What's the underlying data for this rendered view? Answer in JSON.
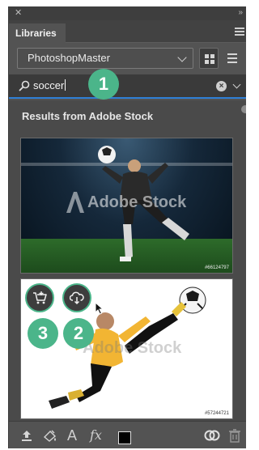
{
  "panel": {
    "close_glyph": "✕",
    "collapse_glyph": "»",
    "tab_label": "Libraries"
  },
  "library": {
    "selected": "PhotoshopMaster"
  },
  "search": {
    "value": "soccer",
    "clear_glyph": "×"
  },
  "results": {
    "title": "Results from Adobe Stock",
    "items": [
      {
        "watermark": "Adobe Stock",
        "id": "#66124797"
      },
      {
        "watermark": "Adobe Stock",
        "id": "#57244721"
      }
    ]
  },
  "steps": [
    "1",
    "2",
    "3"
  ],
  "footer": {
    "text_glyph": "A",
    "fx_glyph": "fx"
  },
  "colors": {
    "panel_bg": "#535353",
    "accent_green": "#4bb58a",
    "search_focus": "#2f7fd6"
  },
  "icons": [
    "close-icon",
    "collapse-icon",
    "panel-menu-icon",
    "chevron-down-icon",
    "grid-view-icon",
    "list-view-icon",
    "search-icon",
    "clear-icon",
    "cart-icon",
    "cloud-download-icon",
    "upload-icon",
    "paint-icon",
    "text-icon",
    "fx-icon",
    "color-icon",
    "cc-icon",
    "trash-icon"
  ]
}
